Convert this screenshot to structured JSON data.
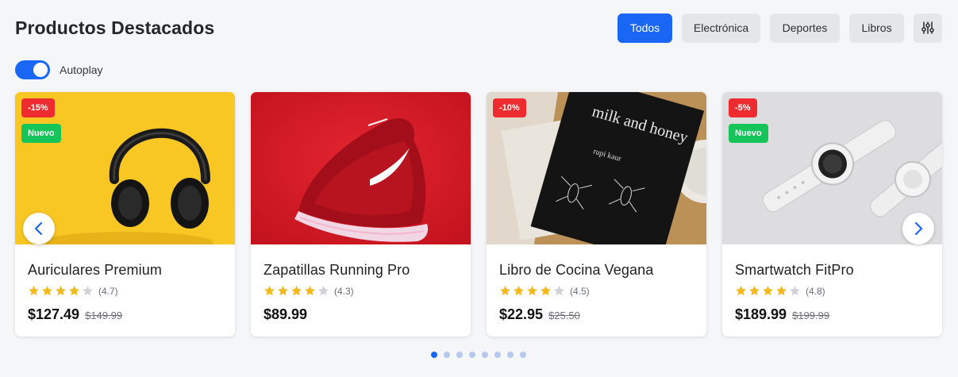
{
  "header": {
    "title": "Productos Destacados"
  },
  "filters": [
    {
      "label": "Todos",
      "active": true
    },
    {
      "label": "Electrónica",
      "active": false
    },
    {
      "label": "Deportes",
      "active": false
    },
    {
      "label": "Libros",
      "active": false
    }
  ],
  "settings_icon": "sliders-icon",
  "autoplay": {
    "label": "Autoplay",
    "enabled": true
  },
  "products": [
    {
      "name": "Auriculares Premium",
      "rating": 4.7,
      "rating_label": "(4.7)",
      "price": "$127.49",
      "old_price": "$149.99",
      "discount": "-15%",
      "new_badge": "Nuevo",
      "image": "headphones-photo",
      "bg": "#f8c21a"
    },
    {
      "name": "Zapatillas Running Pro",
      "rating": 4.3,
      "rating_label": "(4.3)",
      "price": "$89.99",
      "old_price": "",
      "discount": "",
      "new_badge": "",
      "image": "sneaker-photo",
      "bg": "#d11824"
    },
    {
      "name": "Libro de Cocina Vegana",
      "rating": 4.5,
      "rating_label": "(4.5)",
      "price": "$22.95",
      "old_price": "$25.50",
      "discount": "-10%",
      "new_badge": "",
      "image": "book-photo",
      "bg": "#b5894f",
      "book_title": "milk and honey",
      "book_author": "rupi kaur"
    },
    {
      "name": "Smartwatch FitPro",
      "rating": 4.8,
      "rating_label": "(4.8)",
      "price": "$189.99",
      "old_price": "$199.99",
      "discount": "-5%",
      "new_badge": "Nuevo",
      "image": "smartwatch-photo",
      "bg": "#d6d6d8"
    }
  ],
  "carousel": {
    "page_count": 8,
    "current_page": 1
  },
  "colors": {
    "accent": "#1a67f5",
    "discount": "#ee2b2f",
    "new": "#16c55a",
    "star": "#f5b81c"
  }
}
